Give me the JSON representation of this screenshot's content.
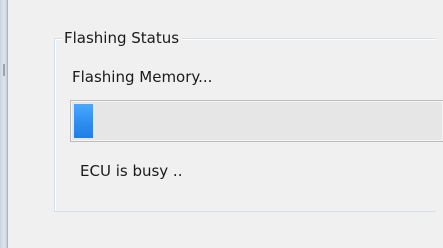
{
  "flashing_status": {
    "group_title": "Flashing Status",
    "status_text": "Flashing Memory...",
    "progress_fraction": 0.05,
    "progress_color": "#2d8ef0",
    "busy_text": "ECU is busy .."
  }
}
